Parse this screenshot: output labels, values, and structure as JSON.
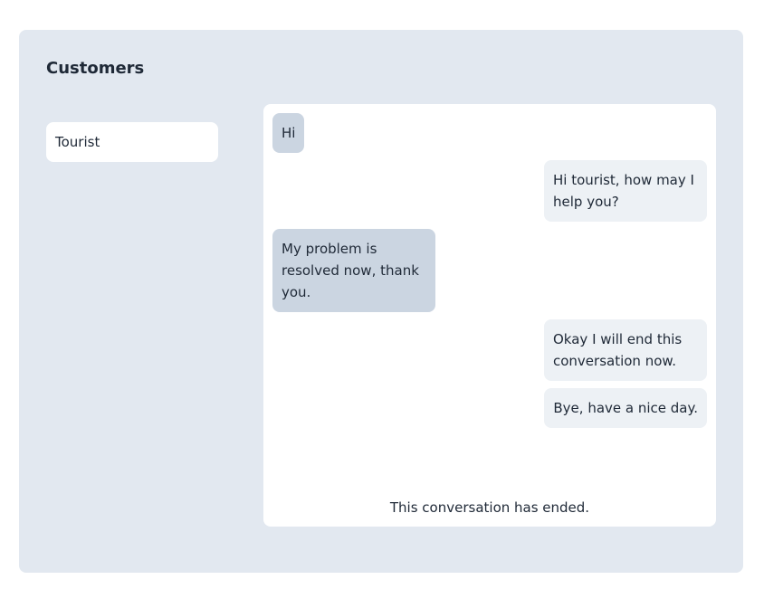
{
  "panel": {
    "title": "Customers"
  },
  "customers": [
    {
      "name": "Tourist"
    }
  ],
  "chat": {
    "messages": [
      {
        "sender": "customer",
        "text": "Hi"
      },
      {
        "sender": "agent",
        "text": "Hi tourist, how may I help you?"
      },
      {
        "sender": "customer",
        "text": "My problem is resolved now, thank you."
      },
      {
        "sender": "agent",
        "text": "Okay I will end this conversation now."
      },
      {
        "sender": "agent",
        "text": "Bye, have a nice day."
      }
    ],
    "status": "This conversation has ended."
  },
  "colors": {
    "panel_bg": "#e2e8f0",
    "customer_bubble": "#cbd5e1",
    "agent_bubble": "#edf1f5",
    "text": "#1f2937"
  }
}
